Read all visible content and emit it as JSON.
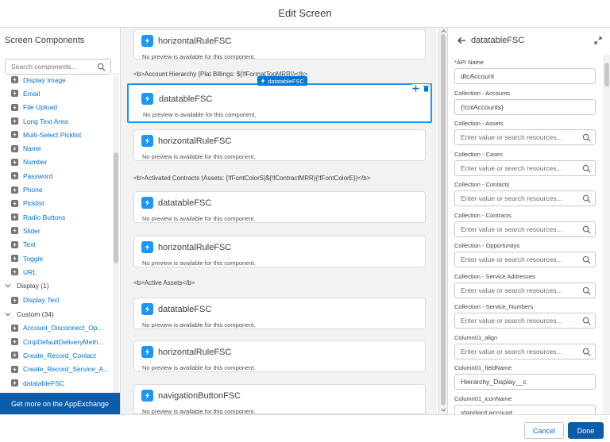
{
  "header": {
    "title": "Edit Screen"
  },
  "left": {
    "title": "Screen Components",
    "search_placeholder": "Search components...",
    "items_top": [
      {
        "label": "Display Image"
      },
      {
        "label": "Email"
      },
      {
        "label": "File Upload"
      },
      {
        "label": "Long Text Area"
      },
      {
        "label": "Multi-Select Picklist"
      },
      {
        "label": "Name"
      },
      {
        "label": "Number"
      },
      {
        "label": "Password"
      },
      {
        "label": "Phone"
      },
      {
        "label": "Picklist"
      },
      {
        "label": "Radio Buttons"
      },
      {
        "label": "Slider"
      },
      {
        "label": "Text"
      },
      {
        "label": "Toggle"
      },
      {
        "label": "URL"
      }
    ],
    "display_group": "Display (1)",
    "display_items": [
      {
        "label": "Display Text"
      }
    ],
    "custom_group": "Custom (34)",
    "custom_items": [
      {
        "label": "Account_Disconnect_Op..."
      },
      {
        "label": "CmpDefaultDeliveryMeth..."
      },
      {
        "label": "Create_Record_Contact"
      },
      {
        "label": "Create_Record_Service_A..."
      },
      {
        "label": "datatableFSC"
      }
    ],
    "appexchange": "Get more on the AppExchange"
  },
  "canvas": {
    "no_preview": "No preview is available for this component.",
    "selected_badge": "datatableFSC",
    "cards": [
      {
        "title": "horizontalRuleFSC"
      },
      {
        "title": "datatableFSC"
      },
      {
        "title": "horizontalRuleFSC"
      },
      {
        "title": "datatableFSC"
      },
      {
        "title": "horizontalRuleFSC"
      },
      {
        "title": "datatableFSC"
      },
      {
        "title": "horizontalRuleFSC"
      },
      {
        "title": "navigationButtonFSC"
      }
    ],
    "headings": [
      "<b>Account Hierarchy (Plat Billings: ${!fFormatTopMRR})</b>",
      "<b>Activated Contracts (Assets: {!fFontColorS}${!fContractMRR}{!fFontColorE})</b>",
      "<b>Active Assets</b>"
    ]
  },
  "right": {
    "title": "datatableFSC",
    "search_placeholder": "Enter value or search resources...",
    "fields": [
      {
        "label": "API Name",
        "value": "dtcAccount",
        "required": true
      },
      {
        "label": "Collection - Accounts",
        "value": "{!colAccounts}"
      },
      {
        "label": "Collection - Assets",
        "value": ""
      },
      {
        "label": "Collection - Cases",
        "value": ""
      },
      {
        "label": "Collection - Contacts",
        "value": ""
      },
      {
        "label": "Collection - Contracts",
        "value": ""
      },
      {
        "label": "Collection - Opportunitys",
        "value": ""
      },
      {
        "label": "Collection - Service Addresses",
        "value": ""
      },
      {
        "label": "Collection - Service_Numbers",
        "value": ""
      },
      {
        "label": "Column01_align",
        "value": ""
      },
      {
        "label": "Column01_fieldName",
        "value": "Hierarchy_Display__c"
      },
      {
        "label": "Column01_iconName",
        "value": "standard:account"
      }
    ]
  },
  "footer": {
    "cancel": "Cancel",
    "done": "Done"
  },
  "colors": {
    "brand": "#0b5cab",
    "link": "#0070d2",
    "component_icon": "#1b96ff",
    "selection": "#1b96ff"
  }
}
